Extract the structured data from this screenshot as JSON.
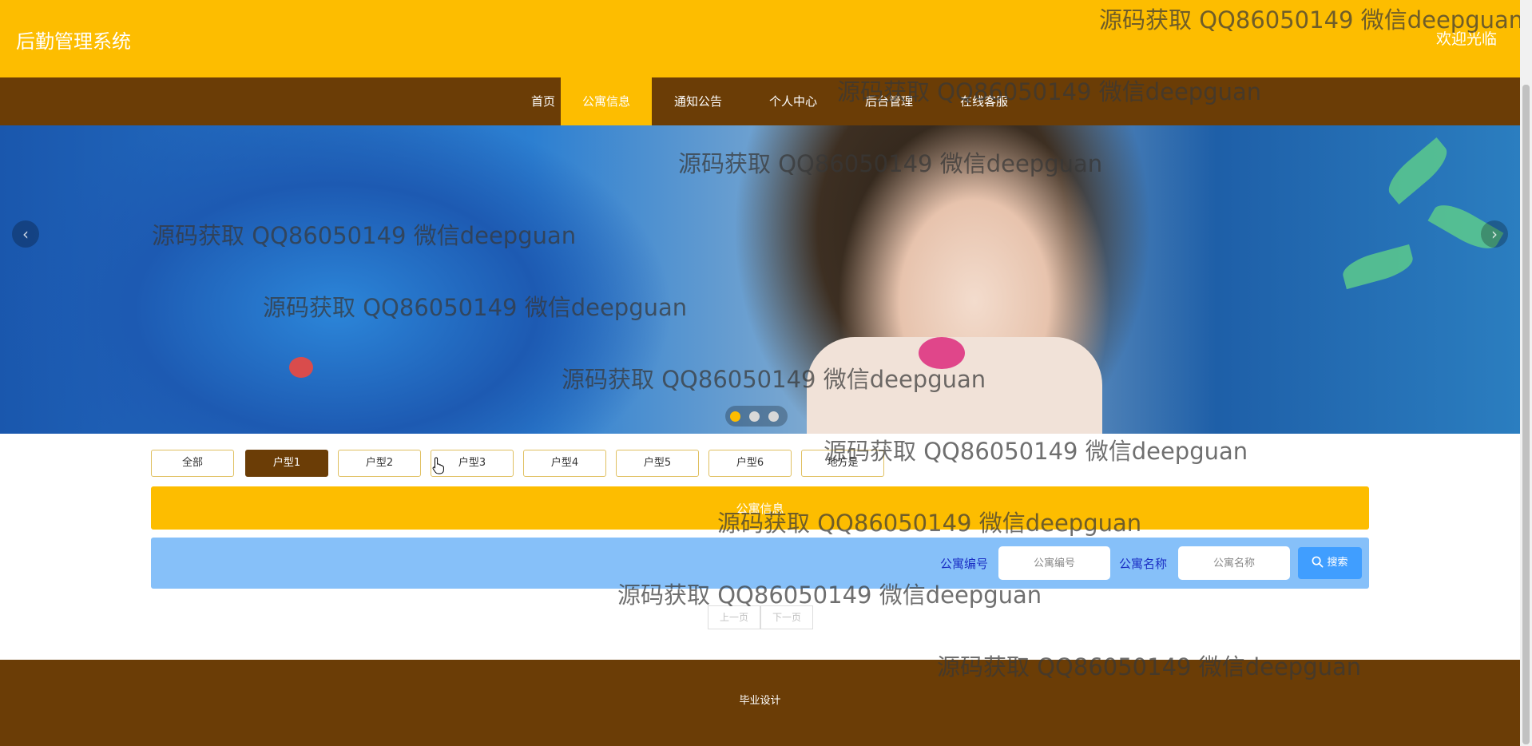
{
  "header": {
    "title": "后勤管理系统",
    "welcome": "欢迎光临"
  },
  "nav": {
    "items": [
      "首页",
      "公寓信息",
      "通知公告",
      "个人中心",
      "后台管理",
      "在线客服"
    ],
    "active": "公寓信息"
  },
  "banner": {
    "prev_icon": "chevron-left-icon",
    "next_icon": "chevron-right-icon",
    "slide_count": 3,
    "active_slide": 1
  },
  "filters": {
    "items": [
      "全部",
      "户型1",
      "户型2",
      "户型3",
      "户型4",
      "户型5",
      "户型6",
      "地方是"
    ],
    "active": "户型1"
  },
  "section": {
    "title": "公寓信息"
  },
  "search": {
    "field1_label": "公寓编号",
    "field1_placeholder": "公寓编号",
    "field2_label": "公寓名称",
    "field2_placeholder": "公寓名称",
    "button_label": "搜索",
    "button_icon": "search-icon"
  },
  "pagination": {
    "prev": "上一页",
    "next": "下一页"
  },
  "footer": {
    "text": "毕业设计"
  },
  "watermark": "源码获取 QQ86050149 微信deepguan",
  "colors": {
    "header": "#fdbd00",
    "nav": "#6b3d06",
    "active": "#fdbd00",
    "search_bar": "#86c0f9",
    "search_button": "#409eff",
    "footer": "#6b3d06"
  }
}
